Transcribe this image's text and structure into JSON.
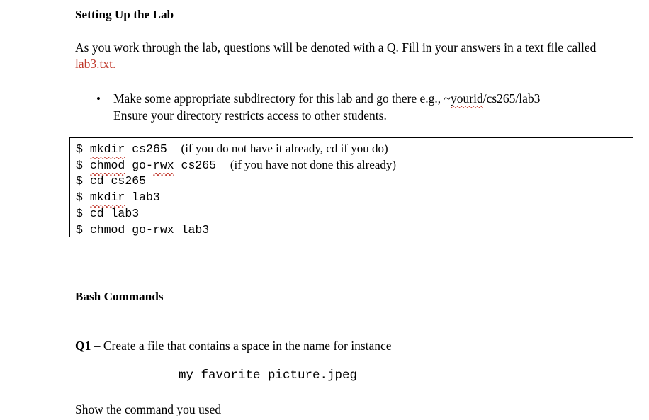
{
  "document": {
    "section_heading": "Setting Up the Lab",
    "intro_paragraph": {
      "before_link": "As you work through the lab, questions will be denoted with a Q. Fill in your answers in a text file called ",
      "filename": "lab3.txt.",
      "filename_color": "#c0392b"
    },
    "bullet_list": [
      {
        "marker": "•",
        "line1_before": "Make some appropriate subdirectory for this lab and go there e.g., ~",
        "line1_misspelled": "yourid",
        "line1_after": "/cs265/lab3",
        "line2": "Ensure your directory restricts access to other students."
      }
    ],
    "code_box": {
      "lines": [
        {
          "prompt": "$ ",
          "cmd": "mkdir",
          "cmd_misspelled": true,
          "args_before": " cs265  ",
          "arg2": "",
          "arg2_misspelled": false,
          "args_after": "",
          "comment": "(if you do not have it already, cd if you do)"
        },
        {
          "prompt": "$ ",
          "cmd": "chmod",
          "cmd_misspelled": true,
          "args_before": " go-",
          "arg2": "rwx",
          "arg2_misspelled": true,
          "args_after": " cs265  ",
          "comment": "(if you have not done this already)"
        },
        {
          "prompt": "$ ",
          "cmd": "cd",
          "cmd_misspelled": false,
          "args_before": " cs265",
          "arg2": "",
          "arg2_misspelled": false,
          "args_after": "",
          "comment": ""
        },
        {
          "prompt": "$ ",
          "cmd": "mkdir",
          "cmd_misspelled": true,
          "args_before": " lab3",
          "arg2": "",
          "arg2_misspelled": false,
          "args_after": "",
          "comment": ""
        },
        {
          "prompt": "$ ",
          "cmd": "cd",
          "cmd_misspelled": false,
          "args_before": " lab3",
          "arg2": "",
          "arg2_misspelled": false,
          "args_after": "",
          "comment": ""
        },
        {
          "prompt": "$ ",
          "cmd": "chmod",
          "cmd_misspelled": true,
          "args_before": " go-",
          "arg2": "rwx",
          "arg2_misspelled": true,
          "args_after": " lab3",
          "comment": ""
        }
      ]
    },
    "bash_heading": "Bash Commands",
    "question": {
      "label": "Q1",
      "text": " – Create a file that contains a space in the name for instance"
    },
    "mono_example": "my favorite picture.jpeg",
    "closing_line": "Show the command you used"
  }
}
